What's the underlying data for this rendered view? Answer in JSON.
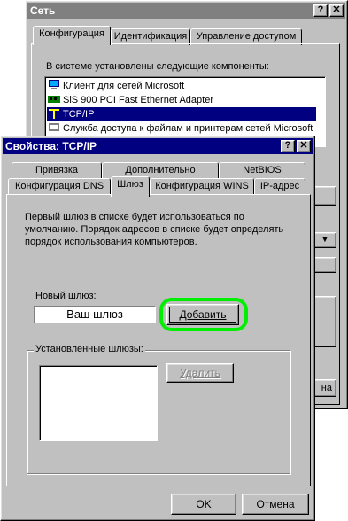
{
  "back_window": {
    "title": "Сеть",
    "tabs": [
      "Конфигурация",
      "Идентификация",
      "Управление доступом"
    ],
    "components_label": "В системе установлены следующие компоненты:",
    "components": [
      {
        "icon": "network-client-icon",
        "label": "Клиент для сетей Microsoft"
      },
      {
        "icon": "network-adapter-icon",
        "label": "SiS 900 PCI Fast Ethernet Adapter"
      },
      {
        "icon": "protocol-icon",
        "label": "TCP/IP",
        "selected": true
      },
      {
        "icon": "service-icon",
        "label": "Служба доступа к файлам и принтерам сетей Microsoft"
      }
    ],
    "cancel_label": "на"
  },
  "dialog": {
    "title": "Свойства: TCP/IP",
    "tabs_row1": [
      "Привязка",
      "Дополнительно",
      "NetBIOS"
    ],
    "tabs_row2": [
      "Конфигурация DNS",
      "Шлюз",
      "Конфигурация WINS",
      "IP-адрес"
    ],
    "description": "Первый шлюз в списке будет использоваться по умолчанию. Порядок адресов в списке будет определять порядок использования компьютеров.",
    "new_gateway_label": "Новый шлюз:",
    "new_gateway_value": "Ваш шлюз",
    "add_button": "Добавить",
    "installed_label": "Установленные шлюзы:",
    "remove_button": "Удалить",
    "ok_button": "OK",
    "cancel_button": "Отмена"
  },
  "colors": {
    "active_title": "#000080",
    "inactive_title": "#808080",
    "highlight": "#00ee00"
  }
}
